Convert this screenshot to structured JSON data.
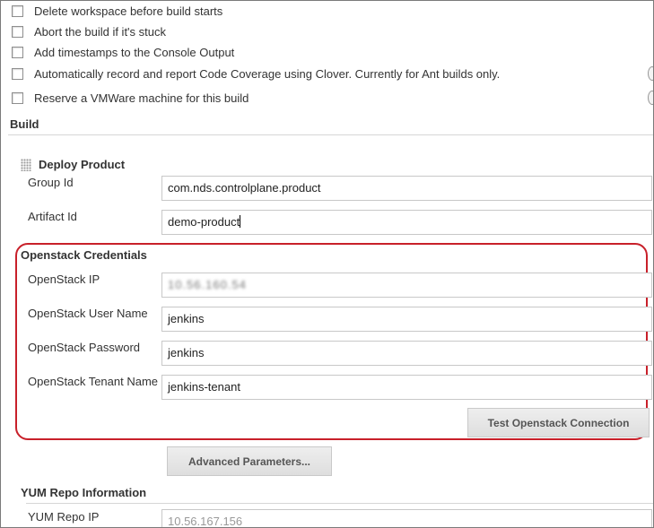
{
  "options": [
    {
      "label": "Delete workspace before build starts"
    },
    {
      "label": "Abort the build if it's stuck"
    },
    {
      "label": "Add timestamps to the Console Output"
    },
    {
      "label": "Automatically record and report Code Coverage using Clover. Currently for Ant builds only."
    },
    {
      "label": "Reserve a VMWare machine for this build"
    }
  ],
  "build": {
    "title": "Build",
    "plugin_title": "Deploy Product",
    "group_id": {
      "label": "Group Id",
      "value": "com.nds.controlplane.product"
    },
    "artifact_id": {
      "label": "Artifact Id",
      "value": "demo-product"
    }
  },
  "openstack": {
    "title": "Openstack Credentials",
    "ip": {
      "label": "OpenStack IP",
      "value": "10.56.160.54"
    },
    "user": {
      "label": "OpenStack User Name",
      "value": "jenkins"
    },
    "password": {
      "label": "OpenStack Password",
      "value": "jenkins"
    },
    "tenant": {
      "label": "OpenStack Tenant Name",
      "value": "jenkins-tenant"
    },
    "test_button": "Test Openstack Connection"
  },
  "advanced_button": "Advanced Parameters...",
  "yum": {
    "title": "YUM Repo Information",
    "ip": {
      "label": "YUM Repo IP",
      "value": "10.56.167.156"
    }
  },
  "colors": {
    "highlight": "#c8202a"
  }
}
